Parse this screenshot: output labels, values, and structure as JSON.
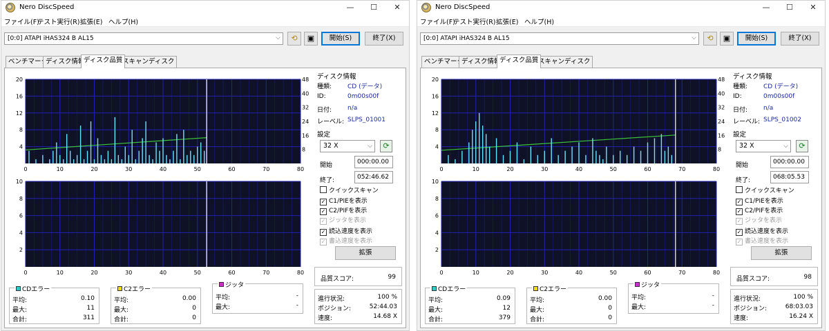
{
  "windows": [
    {
      "title": "Nero DiscSpeed",
      "window_buttons": {
        "minimize": "—",
        "maximize": "☐",
        "close": "✕"
      },
      "menu": [
        "ファイル(F)",
        "テスト実行(R)",
        "拡張(E)",
        "ヘルプ(H)"
      ],
      "drive": "[0:0]   ATAPI iHAS324   B AL15",
      "buttons": {
        "start": "開始(S)",
        "exit": "終了(X)"
      },
      "tabs": [
        "ベンチマーク",
        "ディスク情報",
        "ディスク品質",
        "スキャンディスク"
      ],
      "active_tab": 2,
      "disc_info": {
        "title": "ディスク情報",
        "rows": [
          {
            "key": "種類:",
            "value": "CD (データ)"
          },
          {
            "key": "ID:",
            "value": "0m00s00f"
          },
          {
            "key": "日付:",
            "value": "n/a"
          },
          {
            "key": "レーベル:",
            "value": "SLPS_01001"
          }
        ]
      },
      "settings": {
        "title": "設定",
        "speed": "32 X",
        "start_label": "開始",
        "start_value": "000:00.00",
        "end_label": "終了:",
        "end_value": "052:46.62",
        "checkboxes": [
          {
            "label": "クイックスキャン",
            "checked": false,
            "disabled": false
          },
          {
            "label": "C1/PIEを表示",
            "checked": true,
            "disabled": false
          },
          {
            "label": "C2/PIFを表示",
            "checked": true,
            "disabled": false
          },
          {
            "label": "ジッタを表示",
            "checked": true,
            "disabled": true
          },
          {
            "label": "読込速度を表示",
            "checked": true,
            "disabled": false
          },
          {
            "label": "書込速度を表示",
            "checked": true,
            "disabled": true
          }
        ],
        "expand_button": "拡張"
      },
      "quality_score": {
        "label": "品質スコア:",
        "value": "99"
      },
      "cd_errors": {
        "title": "CDエラー",
        "rows": [
          {
            "key": "平均:",
            "value": "0.10"
          },
          {
            "key": "最大:",
            "value": "11"
          },
          {
            "key": "合計:",
            "value": "311"
          }
        ]
      },
      "c2_errors": {
        "title": "C2エラー",
        "rows": [
          {
            "key": "平均:",
            "value": "0.00"
          },
          {
            "key": "最大:",
            "value": "0"
          },
          {
            "key": "合計:",
            "value": "0"
          }
        ]
      },
      "jitter": {
        "title": "ジッタ",
        "rows": [
          {
            "key": "平均:",
            "value": "-"
          },
          {
            "key": "最大:",
            "value": "-"
          }
        ]
      },
      "progress": {
        "rows": [
          {
            "key": "進行状況:",
            "value": "100 %"
          },
          {
            "key": "ポジション:",
            "value": "52:44.03"
          },
          {
            "key": "速度:",
            "value": "14.68 X"
          }
        ]
      },
      "chart_data": [
        {
          "type": "bar",
          "title": "",
          "x_ticks": [
            0,
            10,
            20,
            30,
            40,
            50,
            60,
            70,
            80
          ],
          "xlim": [
            0,
            80
          ],
          "ylim": [
            0,
            20
          ],
          "y_ticks": [
            4,
            8,
            12,
            16,
            20
          ],
          "y2lim": [
            0,
            48
          ],
          "y2_ticks": [
            8,
            16,
            24,
            32,
            40,
            48
          ],
          "position_marker": 52.7,
          "series": [
            {
              "name": "C1",
              "x": [
                1,
                3,
                5,
                7,
                8,
                9,
                10,
                11,
                12,
                13,
                14,
                15,
                16,
                17,
                18,
                19,
                20,
                21,
                22,
                23,
                24,
                25,
                26,
                27,
                28,
                29,
                30,
                31,
                32,
                33,
                34,
                35,
                36,
                37,
                38,
                39,
                40,
                41,
                42,
                43,
                44,
                45,
                46,
                47,
                48,
                49,
                50,
                51,
                52
              ],
              "values": [
                3,
                1,
                2,
                1,
                3,
                5,
                2,
                1,
                7,
                3,
                1,
                2,
                9,
                1,
                3,
                10,
                1,
                6,
                2,
                1,
                3,
                1,
                11,
                2,
                1,
                4,
                2,
                8,
                1,
                3,
                6,
                10,
                2,
                1,
                5,
                3,
                6,
                2,
                1,
                3,
                7,
                1,
                8,
                2,
                3,
                2,
                4,
                5,
                3
              ]
            },
            {
              "name": "読込速度",
              "x": [
                0,
                52.7
              ],
              "values": [
                7.7,
                14.7
              ]
            }
          ]
        },
        {
          "type": "bar",
          "title": "",
          "x_ticks": [
            0,
            10,
            20,
            30,
            40,
            50,
            60,
            70,
            80
          ],
          "xlim": [
            0,
            80
          ],
          "ylim": [
            0,
            10
          ],
          "y_ticks": [
            2,
            4,
            6,
            8,
            10
          ],
          "position_marker": 52.7,
          "series": [
            {
              "name": "C2",
              "x": [],
              "values": []
            }
          ]
        }
      ]
    },
    {
      "title": "Nero DiscSpeed",
      "window_buttons": {
        "minimize": "—",
        "maximize": "☐",
        "close": "✕"
      },
      "menu": [
        "ファイル(F)",
        "テスト実行(R)",
        "拡張(E)",
        "ヘルプ(H)"
      ],
      "drive": "[0:0]   ATAPI iHAS324   B AL15",
      "buttons": {
        "start": "開始(S)",
        "exit": "終了(X)"
      },
      "tabs": [
        "ベンチマーク",
        "ディスク情報",
        "ディスク品質",
        "スキャンディスク"
      ],
      "active_tab": 2,
      "disc_info": {
        "title": "ディスク情報",
        "rows": [
          {
            "key": "種類:",
            "value": "CD (データ)"
          },
          {
            "key": "ID:",
            "value": "0m00s00f"
          },
          {
            "key": "日付:",
            "value": "n/a"
          },
          {
            "key": "レーベル:",
            "value": "SLPS_01002"
          }
        ]
      },
      "settings": {
        "title": "設定",
        "speed": "32 X",
        "start_label": "開始",
        "start_value": "000:00.00",
        "end_label": "終了:",
        "end_value": "068:05.53",
        "checkboxes": [
          {
            "label": "クイックスキャン",
            "checked": false,
            "disabled": false
          },
          {
            "label": "C1/PIEを表示",
            "checked": true,
            "disabled": false
          },
          {
            "label": "C2/PIFを表示",
            "checked": true,
            "disabled": false
          },
          {
            "label": "ジッタを表示",
            "checked": true,
            "disabled": true
          },
          {
            "label": "読込速度を表示",
            "checked": true,
            "disabled": false
          },
          {
            "label": "書込速度を表示",
            "checked": true,
            "disabled": true
          }
        ],
        "expand_button": "拡張"
      },
      "quality_score": {
        "label": "品質スコア:",
        "value": "98"
      },
      "cd_errors": {
        "title": "CDエラー",
        "rows": [
          {
            "key": "平均:",
            "value": "0.09"
          },
          {
            "key": "最大:",
            "value": "12"
          },
          {
            "key": "合計:",
            "value": "379"
          }
        ]
      },
      "c2_errors": {
        "title": "C2エラー",
        "rows": [
          {
            "key": "平均:",
            "value": "0.00"
          },
          {
            "key": "最大:",
            "value": "0"
          },
          {
            "key": "合計:",
            "value": "0"
          }
        ]
      },
      "jitter": {
        "title": "ジッタ",
        "rows": [
          {
            "key": "平均:",
            "value": "-"
          },
          {
            "key": "最大:",
            "value": "-"
          }
        ]
      },
      "progress": {
        "rows": [
          {
            "key": "進行状況:",
            "value": "100 %"
          },
          {
            "key": "ポジション:",
            "value": "68:03.03"
          },
          {
            "key": "速度:",
            "value": "16.24 X"
          }
        ]
      },
      "chart_data": [
        {
          "type": "bar",
          "title": "",
          "x_ticks": [
            0,
            10,
            20,
            30,
            40,
            50,
            60,
            70,
            80
          ],
          "xlim": [
            0,
            80
          ],
          "ylim": [
            0,
            20
          ],
          "y_ticks": [
            4,
            8,
            12,
            16,
            20
          ],
          "y2lim": [
            0,
            48
          ],
          "y2_ticks": [
            8,
            16,
            24,
            32,
            40,
            48
          ],
          "position_marker": 68.1,
          "series": [
            {
              "name": "C1",
              "x": [
                2,
                4,
                6,
                8,
                9,
                10,
                11,
                12,
                13,
                14,
                16,
                18,
                20,
                22,
                24,
                26,
                28,
                30,
                32,
                34,
                36,
                38,
                40,
                42,
                44,
                45,
                46,
                47,
                48,
                50,
                52,
                54,
                56,
                58,
                60,
                62,
                64,
                65,
                66,
                67
              ],
              "values": [
                2,
                1,
                3,
                5,
                8,
                10,
                12,
                9,
                7,
                4,
                6,
                2,
                3,
                5,
                1,
                4,
                2,
                3,
                6,
                2,
                3,
                4,
                5,
                2,
                6,
                3,
                2,
                1,
                4,
                2,
                3,
                2,
                4,
                3,
                5,
                6,
                7,
                3,
                4,
                2
              ]
            },
            {
              "name": "読込速度",
              "x": [
                0,
                68.1
              ],
              "values": [
                7.5,
                16.2
              ]
            }
          ]
        },
        {
          "type": "bar",
          "title": "",
          "x_ticks": [
            0,
            10,
            20,
            30,
            40,
            50,
            60,
            70,
            80
          ],
          "xlim": [
            0,
            80
          ],
          "ylim": [
            0,
            10
          ],
          "y_ticks": [
            2,
            4,
            6,
            8,
            10
          ],
          "position_marker": 68.1,
          "series": [
            {
              "name": "C2",
              "x": [],
              "values": []
            }
          ]
        }
      ],
      "colors": {
        "plot_bg": "#0f1226",
        "grid": "#2020b0",
        "c1_bars": "#69e4ff",
        "read_speed": "#3cc43c",
        "marker": "#ffffff",
        "cd_error_swatch": "#34c8c8",
        "c2_error_swatch": "#f0e000",
        "jitter_swatch": "#c832c8"
      }
    }
  ]
}
